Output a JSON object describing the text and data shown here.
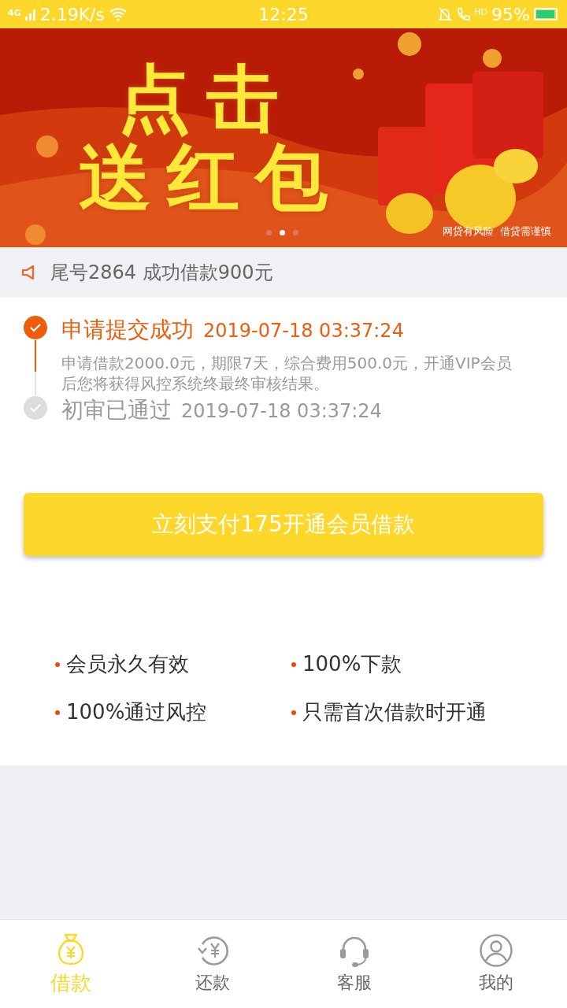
{
  "status_bar": {
    "network": "4G",
    "speed": "2.19K/s",
    "time": "12:25",
    "call_badge": "HD",
    "battery": "95%"
  },
  "banner": {
    "headline": [
      "点击",
      "送红包"
    ],
    "disclaimer": "网贷有风险  借贷需谨慎",
    "dots": [
      {
        "selected": false
      },
      {
        "selected": true
      },
      {
        "selected": false
      }
    ]
  },
  "notice": {
    "text": "尾号2864 成功借款900元"
  },
  "timeline": [
    {
      "title": "申请提交成功",
      "time": "2019-07-18 03:37:24",
      "detail": "申请借款2000.0元，期限7天，综合费用500.0元，开通VIP会员后您将获得风控系统终最终审核结果。",
      "done": true
    },
    {
      "title": "初审已通过",
      "time": "2019-07-18 03:37:24",
      "done": false
    }
  ],
  "pay_button": "立刻支付175开通会员借款",
  "benefits": [
    "会员永久有效",
    "100%下款",
    "100%通过风控",
    "只需首次借款时开通"
  ],
  "tabs": [
    {
      "label": "借款",
      "kind": "bag",
      "selected": true
    },
    {
      "label": "还款",
      "kind": "repay",
      "selected": false
    },
    {
      "label": "客服",
      "kind": "headset",
      "selected": false
    },
    {
      "label": "我的",
      "kind": "user",
      "selected": false
    }
  ]
}
